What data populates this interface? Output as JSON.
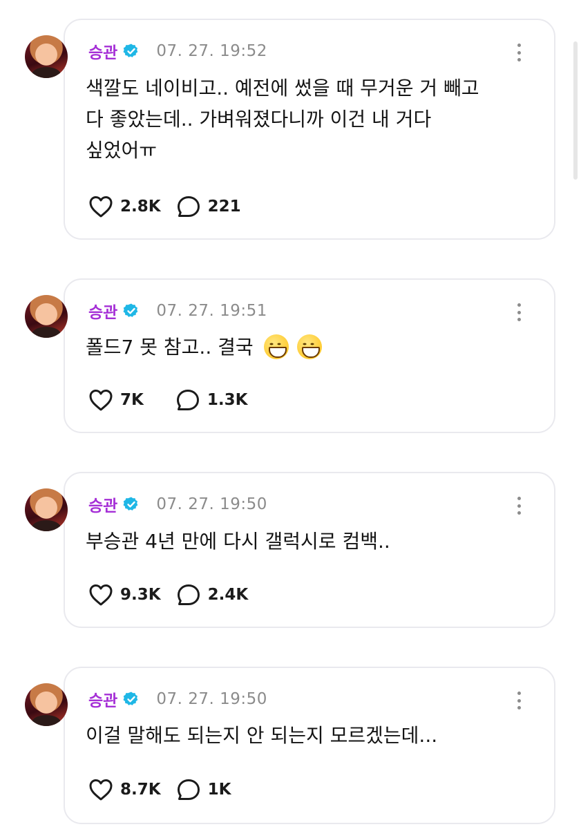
{
  "posts": [
    {
      "username": "승관",
      "timestamp": "07. 27. 19:52",
      "text": "색깔도 네이비고.. 예전에 썼을 때 무거운 거 빼고\n다 좋았는데.. 가벼워졌다니까 이건 내 거다\n싶었어ㅠ",
      "emoji_count": 0,
      "likes": "2.8K",
      "replies": "221"
    },
    {
      "username": "승관",
      "timestamp": "07. 27. 19:51",
      "text": "폴드7 못 참고.. 결국 ",
      "emoji_count": 2,
      "likes": "7K",
      "replies": "1.3K"
    },
    {
      "username": "승관",
      "timestamp": "07. 27. 19:50",
      "text": "부승관 4년 만에 다시 갤럭시로 컴백..",
      "emoji_count": 0,
      "likes": "9.3K",
      "replies": "2.4K"
    },
    {
      "username": "승관",
      "timestamp": "07. 27. 19:50",
      "text": "이걸 말해도 되는지 안 되는지 모르겠는데...",
      "emoji_count": 0,
      "likes": "8.7K",
      "replies": "1K"
    }
  ],
  "icons": {
    "verified": "verified-badge-icon",
    "like": "heart-icon",
    "reply": "speech-bubble-icon",
    "more": "more-vertical-icon",
    "emoji": "grinning-face-emoji"
  },
  "colors": {
    "username": "#a52fd6",
    "verified": "#1fb7e6",
    "timestamp": "#8b8b8b",
    "border": "#e9e9ee"
  }
}
